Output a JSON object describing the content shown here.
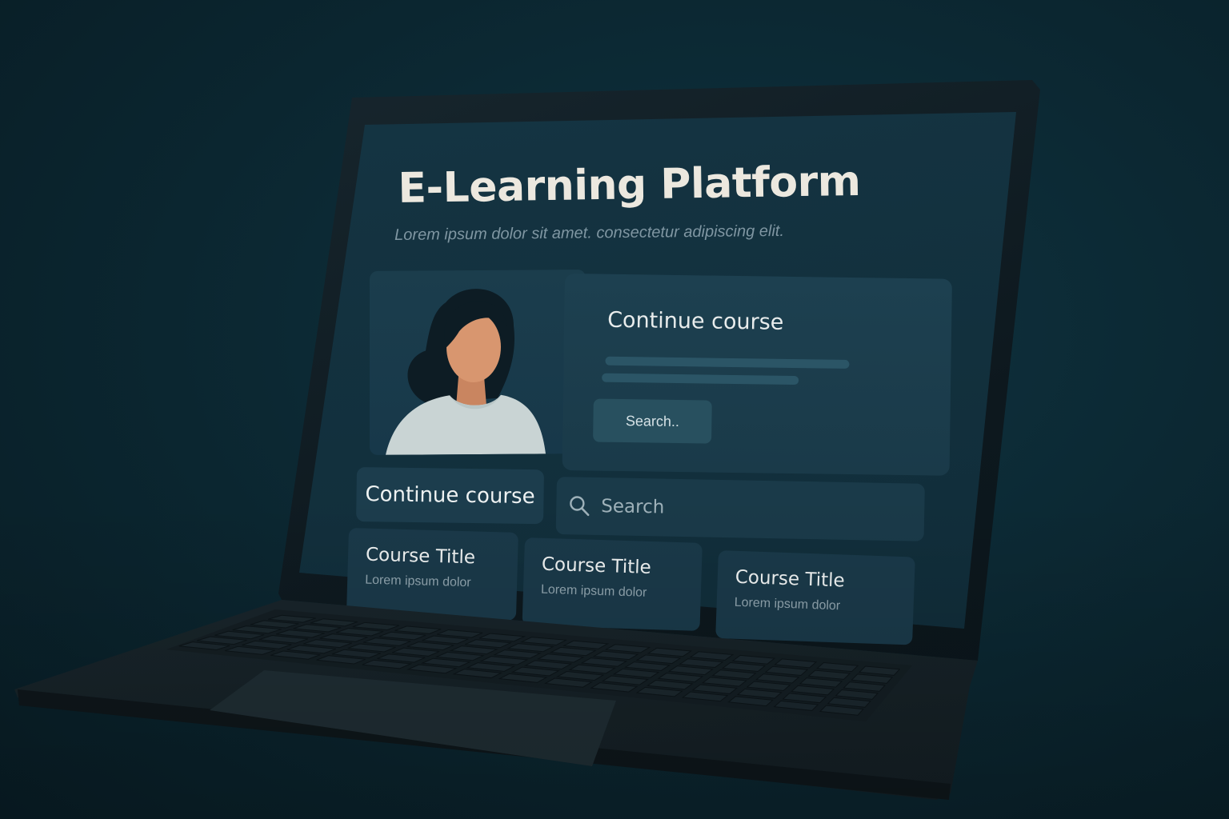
{
  "page": {
    "title": "E-Learning Platform",
    "subtitle": "Lorem ipsum dolor sit amet. consectetur adipiscing elit."
  },
  "hero": {
    "heading": "Continue course",
    "search_button_label": "Search.."
  },
  "actions": {
    "continue_label": "Continue course",
    "search_placeholder": "Search"
  },
  "courses": [
    {
      "title": "Course Title",
      "description": "Lorem ipsum dolor"
    },
    {
      "title": "Course Title",
      "description": "Lorem ipsum dolor"
    },
    {
      "title": "Course Title",
      "description": "Lorem ipsum dolor"
    }
  ],
  "icons": {
    "search": "search-icon",
    "avatar": "user-avatar-illustration"
  },
  "colors": {
    "background": "#0b2630",
    "screen": "#12303d",
    "card": "#1a3a49",
    "title_text": "#ece8df",
    "skin": "#d8966f",
    "hair": "#0d1c24",
    "shirt": "#c9d4d4"
  }
}
